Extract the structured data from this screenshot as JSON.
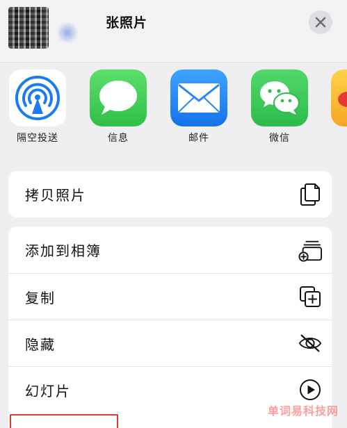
{
  "header": {
    "title": "张照片",
    "close_icon": "close-icon"
  },
  "apps": [
    {
      "label": "隔空投送",
      "icon": "airdrop-icon"
    },
    {
      "label": "信息",
      "icon": "messages-icon",
      "color": "#34c759"
    },
    {
      "label": "邮件",
      "icon": "mail-icon",
      "color": "#1e88f5"
    },
    {
      "label": "微信",
      "icon": "wechat-icon",
      "color": "#3ec85a"
    }
  ],
  "actions_group1": [
    {
      "label": "拷贝照片",
      "icon": "copy-photo-icon"
    }
  ],
  "actions_group2": [
    {
      "label": "添加到相簿",
      "icon": "add-to-album-icon"
    },
    {
      "label": "复制",
      "icon": "duplicate-icon"
    },
    {
      "label": "隐藏",
      "icon": "eye-slash-icon"
    },
    {
      "label": "幻灯片",
      "icon": "play-circle-icon"
    }
  ],
  "watermark": "单词易科技网"
}
